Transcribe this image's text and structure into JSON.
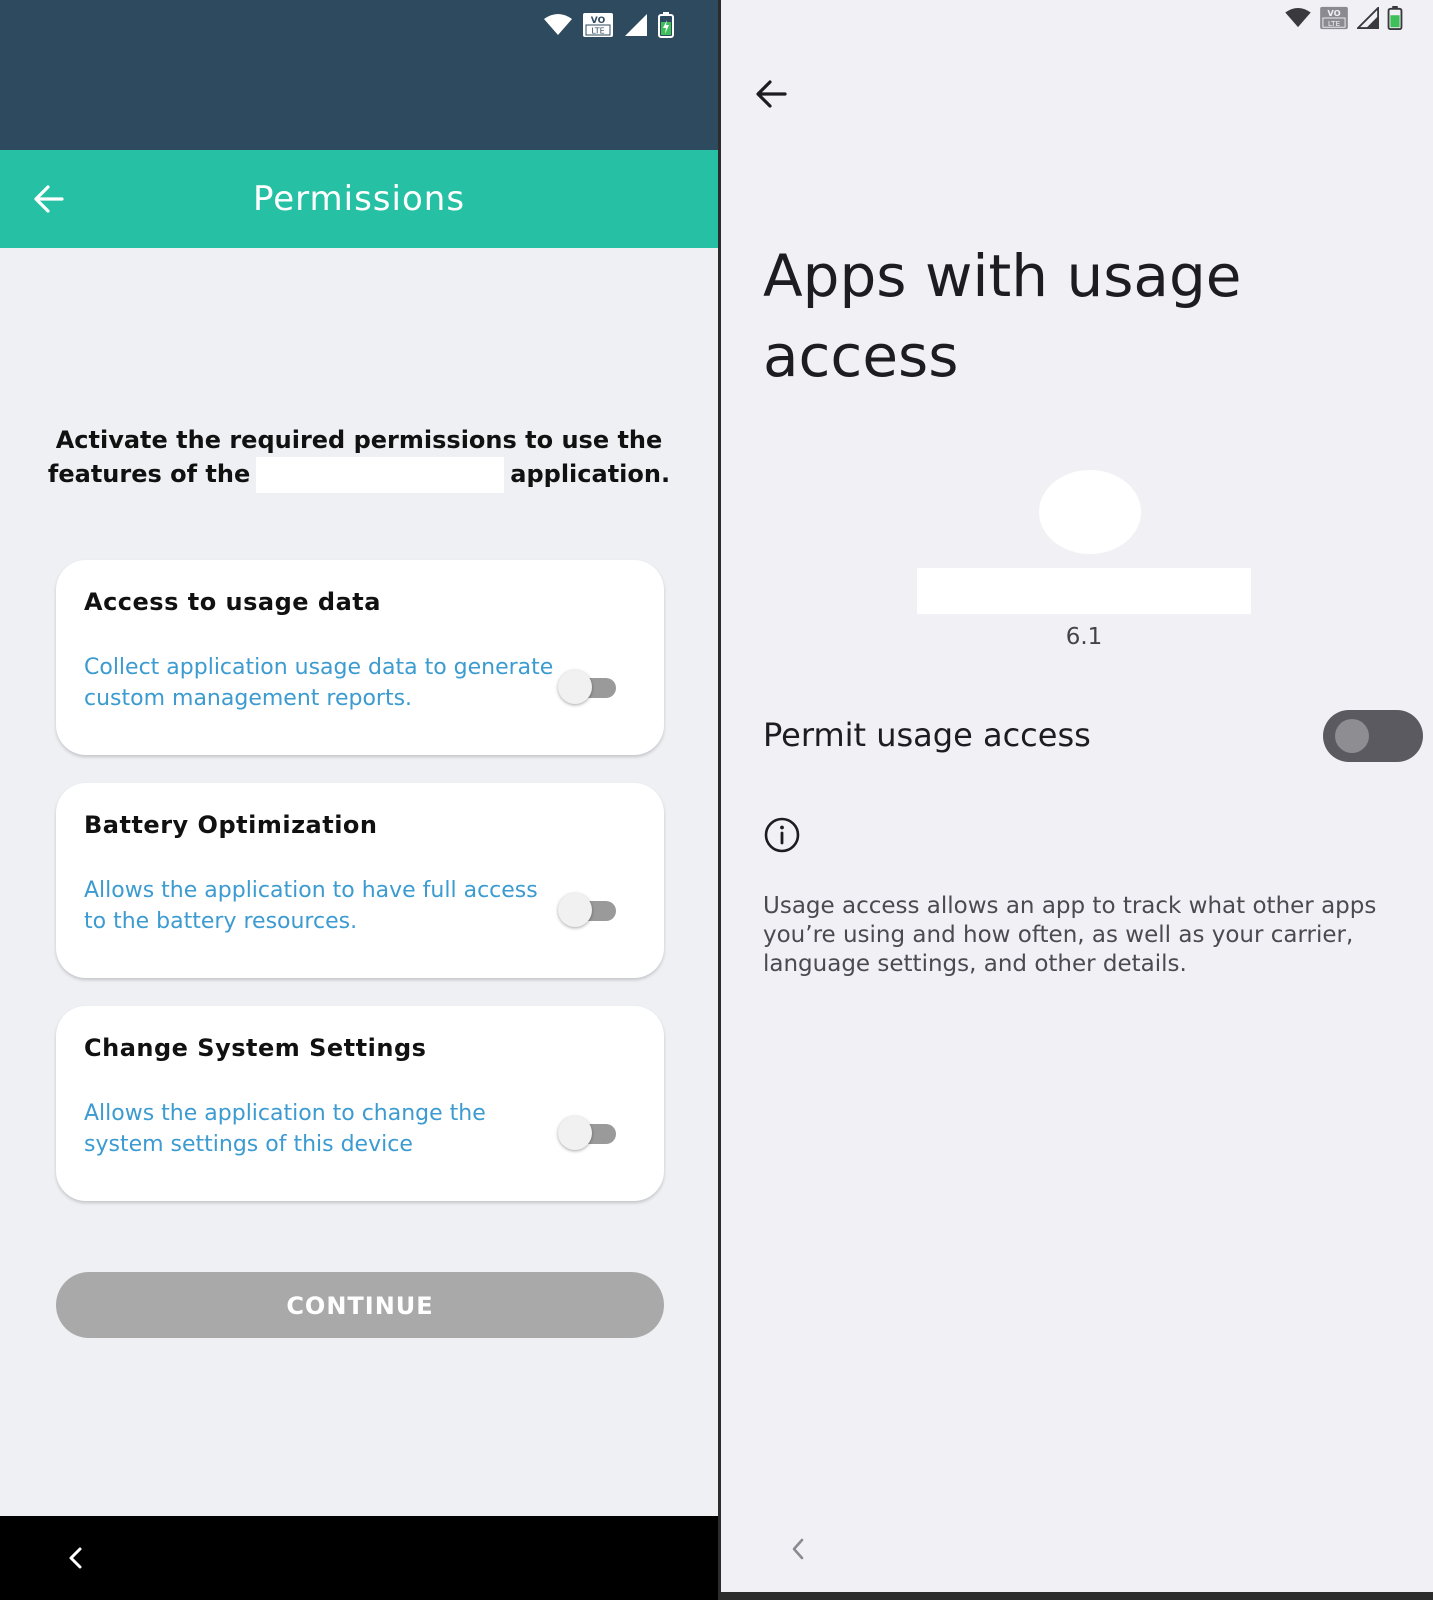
{
  "left": {
    "header": {
      "title": "Permissions"
    },
    "intro": {
      "line1": "Activate the required permissions to use the",
      "line2_prefix": "features of the",
      "line2_suffix": "application."
    },
    "permissions": [
      {
        "title": "Access to usage data",
        "description": "Collect application usage data to generate custom management reports.",
        "enabled": false
      },
      {
        "title": "Battery Optimization",
        "description": "Allows the application to have full access to the battery resources.",
        "enabled": false
      },
      {
        "title": "Change System Settings",
        "description": "Allows the application to change the system settings of this device",
        "enabled": false
      }
    ],
    "continue_label": "CONTINUE",
    "colors": {
      "status_bar": "#2e4a5e",
      "app_bar": "#26c1a4",
      "description_text": "#3c9bd0",
      "continue_disabled": "#a9a9a9"
    }
  },
  "right": {
    "page_title": "Apps with usage access",
    "app_version": "6.1",
    "permit_label": "Permit usage access",
    "permit_enabled": false,
    "info_text": "Usage access allows an app to track what other apps you’re using and how often, as well as your carrier, language settings, and other details."
  },
  "status_icons": [
    "wifi-icon",
    "volte-icon",
    "signal-icon",
    "battery-icon"
  ],
  "nav_icons": [
    "back-arrow-icon",
    "nav-back-chevron-icon",
    "info-icon"
  ]
}
